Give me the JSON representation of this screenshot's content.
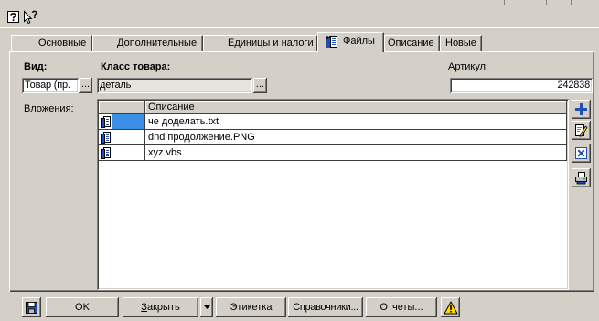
{
  "colors": {
    "face": "#d4d0c8",
    "window": "#ffffff",
    "selection": "#3d8fe6",
    "grid_line": "#3c3c3c",
    "icon_blue": "#1f4fb4",
    "warning_yellow": "#ffd800"
  },
  "toolbar": {
    "help_icon": "help-icon",
    "whats_this_icon": "whats-this-icon"
  },
  "tabs": [
    {
      "label": "Основные",
      "active": false
    },
    {
      "label": "Дополнительные",
      "active": false
    },
    {
      "label": "Единицы и налоги",
      "active": false
    },
    {
      "label": "Файлы",
      "active": true,
      "icon": "attachment-folder-icon"
    },
    {
      "label": "Описание",
      "active": false
    },
    {
      "label": "Новые",
      "active": false
    }
  ],
  "form": {
    "vid": {
      "label": "Вид:",
      "value": "Товар (пр.",
      "browse_label": "..."
    },
    "product_class": {
      "label": "Класс товара:",
      "value": "деталь",
      "browse_label": "..."
    },
    "article": {
      "label": "Артикул:",
      "value": "242838"
    }
  },
  "attachments": {
    "label": "Вложения:",
    "columns": [
      "",
      "Описание"
    ],
    "rows": [
      {
        "icon": "attachment-icon",
        "description": "че доделать.txt",
        "selected": true
      },
      {
        "icon": "attachment-icon",
        "description": "dnd продолжение.PNG",
        "selected": false
      },
      {
        "icon": "attachment-icon",
        "description": "xyz.vbs",
        "selected": false
      }
    ],
    "side_buttons": [
      {
        "icon": "add-icon"
      },
      {
        "icon": "edit-icon"
      },
      {
        "icon": "delete-icon"
      },
      {
        "icon": "print-preview-icon"
      }
    ]
  },
  "bottom_bar": {
    "save_icon": "floppy-save-icon",
    "ok_label": "OK",
    "close_label": "Закрыть",
    "dropdown_icon": "dropdown-arrow-icon",
    "label_button": "Этикетка",
    "references_label": "Справочники...",
    "reports_label": "Отчеты...",
    "warning_icon": "warning-icon"
  }
}
